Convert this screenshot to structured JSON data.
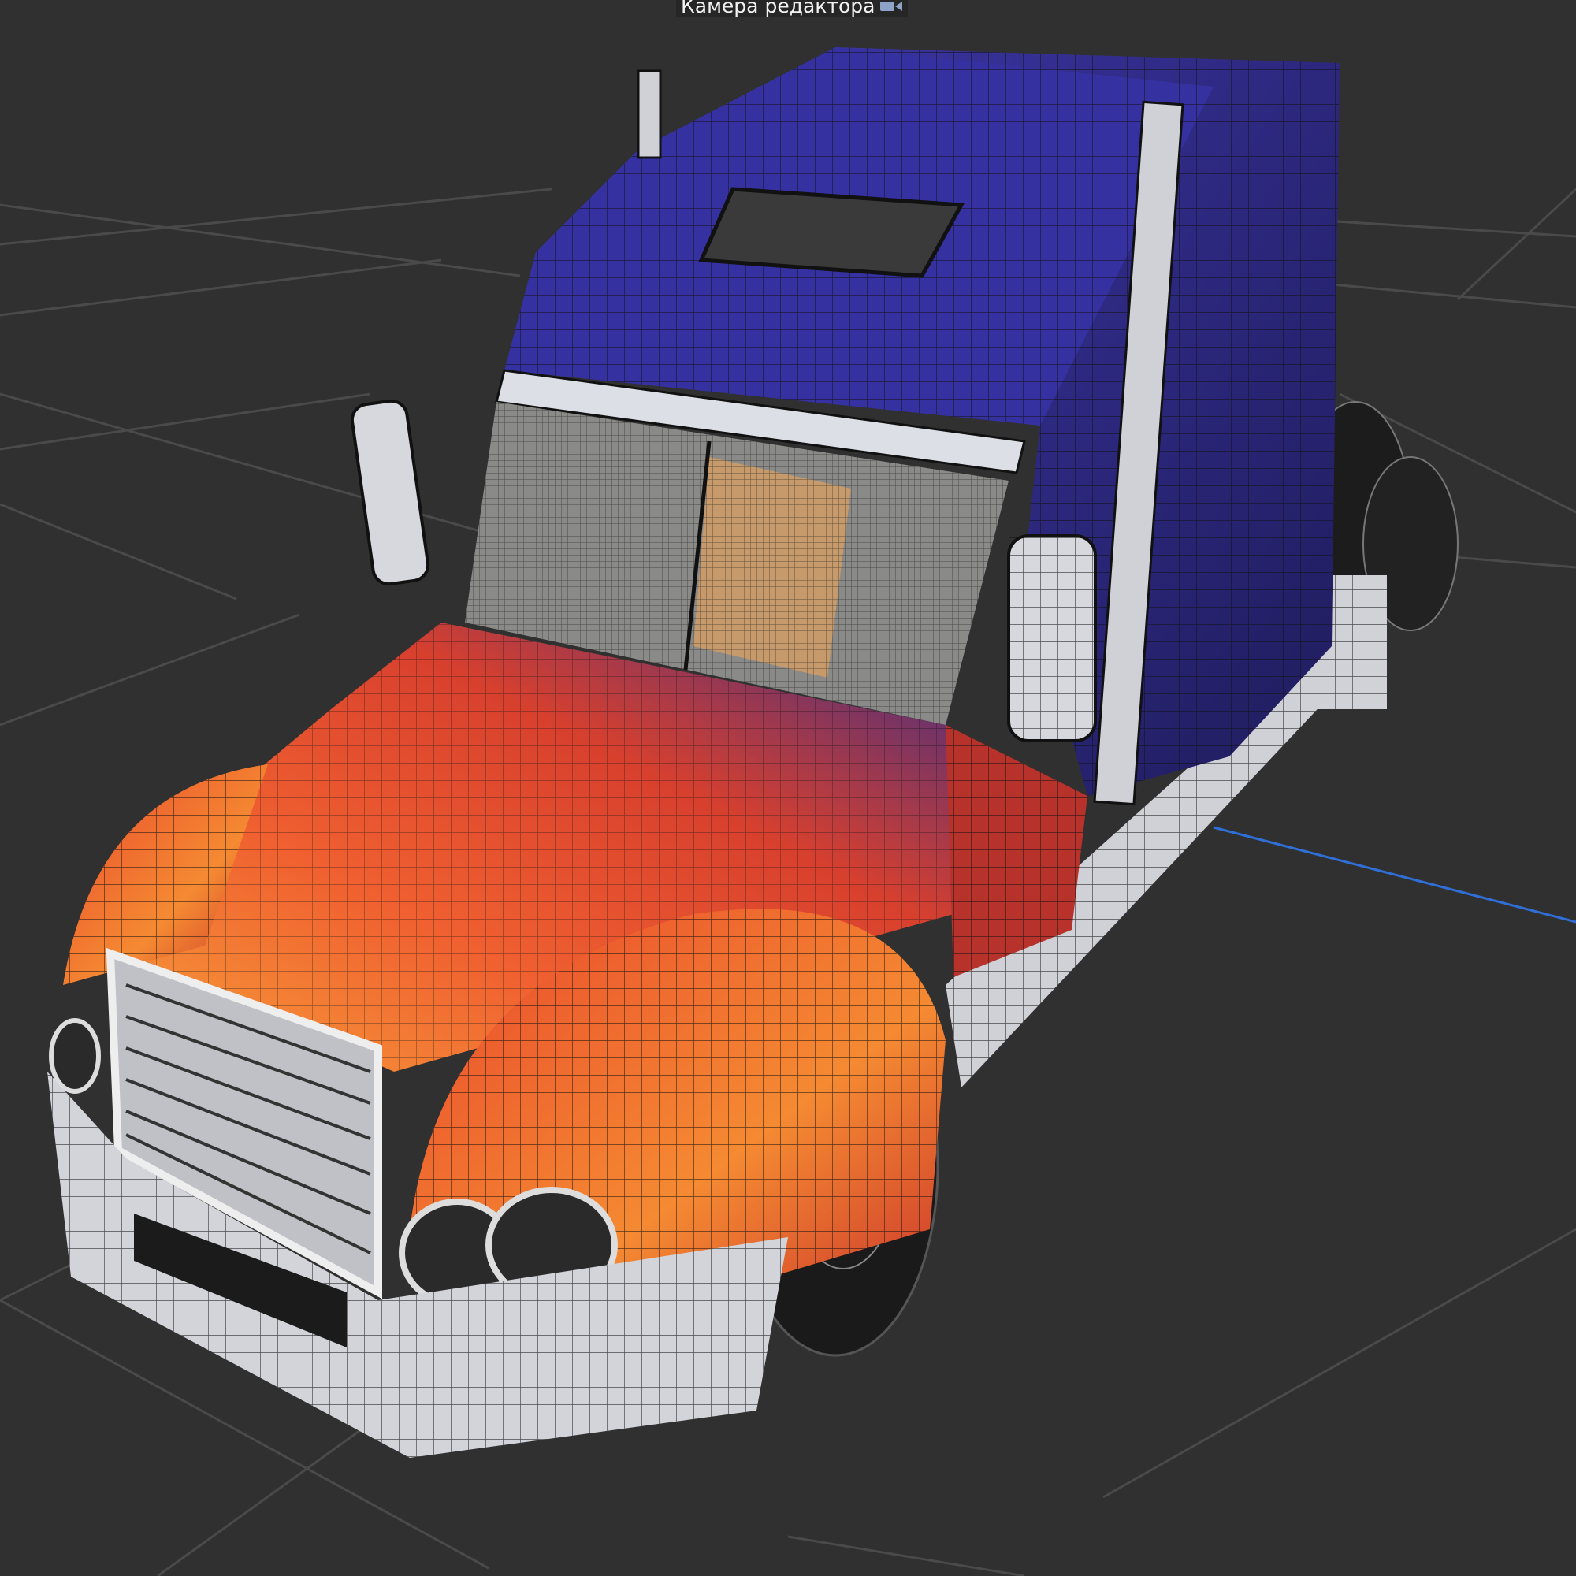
{
  "viewport": {
    "camera_label": "Камера редактора",
    "camera_icon": "video-camera-icon"
  },
  "colors": {
    "background": "#303030",
    "grid": "#4a4a4a",
    "axis_blue": "#2f6fd6",
    "cab_blue": "#2e2a7e",
    "hood_orange": "#f05a2a",
    "chrome": "#c9cbd2"
  }
}
